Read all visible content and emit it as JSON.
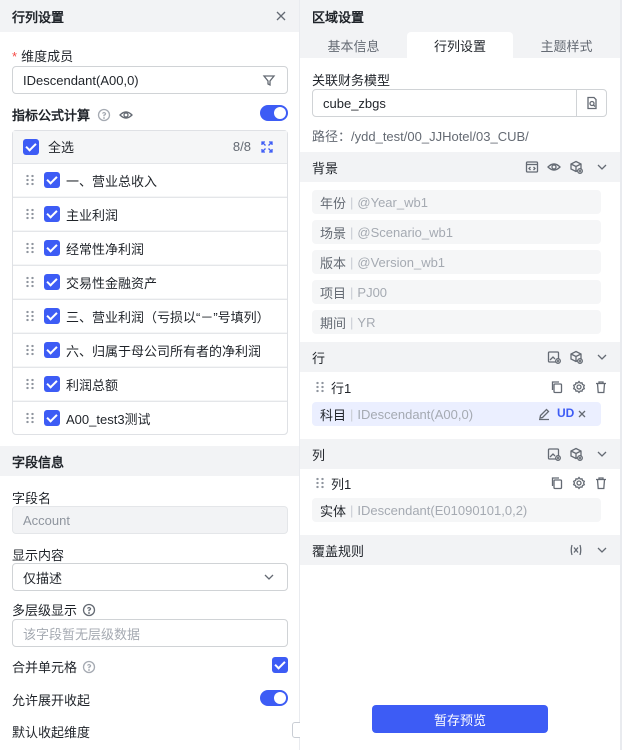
{
  "left_panel": {
    "title": "行列设置",
    "dimension_label": "维度成员",
    "dimension_value": "IDescendant(A00,0)",
    "formula_label": "指标公式计算",
    "select_all": "全选",
    "count": "8/8",
    "members": [
      "一、营业总收入",
      "主业利润",
      "经常性净利润",
      "交易性金融资产",
      "三、营业利润（亏损以“－”号填列）",
      "六、归属于母公司所有者的净利润",
      "利润总额",
      "A00_test3测试"
    ],
    "field_info_title": "字段信息",
    "field_name_label": "字段名",
    "field_name_value": "Account",
    "display_label": "显示内容",
    "display_value": "仅描述",
    "multilevel_label": "多层级显示",
    "multilevel_placeholder": "该字段暂无层级数据",
    "merge_label": "合并单元格",
    "expand_label": "允许展开收起",
    "collapse_label": "默认收起维度"
  },
  "right_panel": {
    "title": "区域设置",
    "tabs": [
      "基本信息",
      "行列设置",
      "主题样式"
    ],
    "model_label": "关联财务模型",
    "model_value": "cube_zbgs",
    "path_label": "路径：",
    "path_value": "/ydd_test/00_JJHotel/03_CUB/",
    "background_title": "背景",
    "background_items": [
      {
        "name": "年份",
        "value": "@Year_wb1"
      },
      {
        "name": "场景",
        "value": "@Scenario_wb1"
      },
      {
        "name": "版本",
        "value": "@Version_wb1"
      },
      {
        "name": "项目",
        "value": "PJ00"
      },
      {
        "name": "期间",
        "value": "YR"
      }
    ],
    "row_title": "行",
    "row1_label": "行1",
    "row_subject_name": "科目",
    "row_subject_value": "IDescendant(A00,0)",
    "row_subject_tag": "UD",
    "col_title": "列",
    "col1_label": "列1",
    "col_entity_name": "实体",
    "col_entity_value": "IDescendant(E01090101,0,2)",
    "override_title": "覆盖规则",
    "save_button": "暂存预览"
  },
  "colors": {
    "accent": "#3d5cf5",
    "header_bg": "#f2f3f5"
  }
}
